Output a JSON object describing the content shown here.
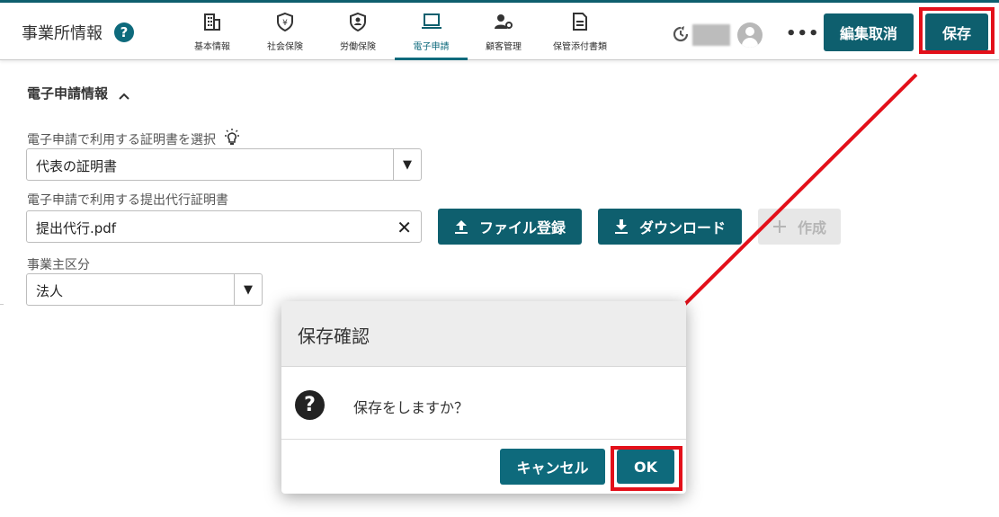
{
  "header": {
    "title": "事業所情報",
    "help_icon": "question-circle-icon",
    "tabs": [
      {
        "label": "基本情報",
        "icon": "building-icon",
        "active": false
      },
      {
        "label": "社会保険",
        "icon": "shield-yen-icon",
        "active": false
      },
      {
        "label": "労働保険",
        "icon": "shield-person-icon",
        "active": false
      },
      {
        "label": "電子申請",
        "icon": "laptop-icon",
        "active": true
      },
      {
        "label": "顧客管理",
        "icon": "user-gear-icon",
        "active": false
      },
      {
        "label": "保管添付書類",
        "icon": "document-icon",
        "active": false
      }
    ],
    "cancel_edit_label": "編集取消",
    "save_label": "保存",
    "more_label": "•••"
  },
  "section": {
    "title": "電子申請情報"
  },
  "fields": {
    "cert_select": {
      "label": "電子申請で利用する証明書を選択",
      "value": "代表の証明書"
    },
    "agent_cert": {
      "label": "電子申請で利用する提出代行証明書",
      "value": "提出代行.pdf"
    },
    "business_type": {
      "label": "事業主区分",
      "value": "法人"
    }
  },
  "actions": {
    "file_register": "ファイル登録",
    "download": "ダウンロード",
    "create": "作成"
  },
  "dialog": {
    "title": "保存確認",
    "message": "保存をしますか？",
    "cancel_label": "キャンセル",
    "ok_label": "OK"
  },
  "colors": {
    "accent": "#0e5f6e",
    "highlight": "#e3101a"
  }
}
